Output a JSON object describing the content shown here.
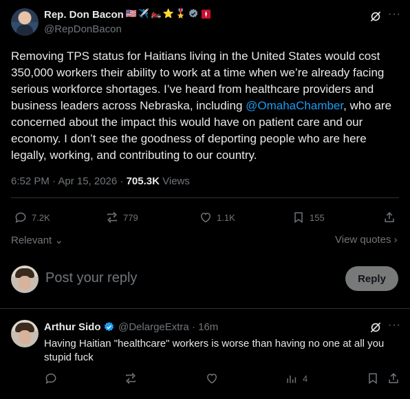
{
  "tweet": {
    "author_name": "Rep. Don Bacon",
    "author_handle": "@RepDonBacon",
    "badges": [
      "🇺🇸",
      "✈️",
      "🏍️",
      "⭐",
      "🎖️"
    ],
    "text_before_mention": "Removing TPS status for Haitians living in the United States would cost 350,000 workers their ability to work at a time when we’re already facing serious workforce shortages. I’ve heard from healthcare providers and business leaders across Nebraska, including ",
    "mention": "@OmahaChamber",
    "text_after_mention": ", who are concerned about the impact this would have on patient care and our economy. I don’t see the goodness of deporting people who are here legally, working, and contributing to our country.",
    "time": "6:52 PM · Apr 15, 2026 · ",
    "views_count": "705.3K",
    "views_label": " Views",
    "stats": {
      "replies": "7.2K",
      "reposts": "779",
      "likes": "1.1K",
      "bookmarks": "155"
    }
  },
  "sort": {
    "relevant_label": "Relevant",
    "view_quotes_label": "View quotes"
  },
  "composer": {
    "placeholder": "Post your reply",
    "reply_button": "Reply"
  },
  "reply": {
    "author_name": "Arthur Sido",
    "author_handle": "@DelargeExtra",
    "time": "16m",
    "text": "Having Haitian \"healthcare\" workers is worse than having no one at all you stupid fuck",
    "views": "4"
  },
  "colors": {
    "background": "#000000",
    "text": "#e7e9ea",
    "muted": "#71767b",
    "accent": "#1d9bf0",
    "divider": "#2f3336"
  }
}
